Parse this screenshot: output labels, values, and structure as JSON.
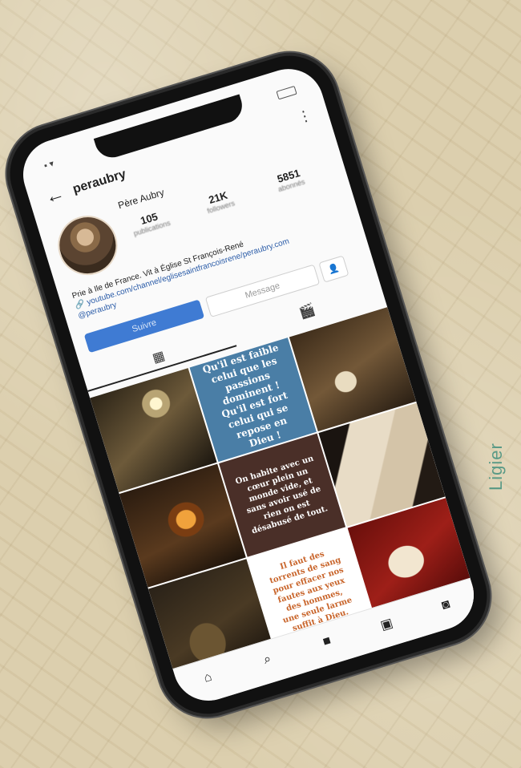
{
  "profile": {
    "username": "peraubry",
    "display_name": "Père Aubry",
    "stats": [
      {
        "value": "105",
        "label": "publications"
      },
      {
        "value": "21K",
        "label": "followers"
      },
      {
        "value": "5851",
        "label": "abonnés"
      }
    ],
    "bio": "Prie à Ile de France. Vit à Église St François-René",
    "link": "youtube.com/channel/eglisesaintfrancoisrene/peraubry.com",
    "handle": "@peraubry"
  },
  "buttons": {
    "follow": "Suivre",
    "message": "Message"
  },
  "quotes": {
    "q1": [
      "Qu'il est faible",
      "celui que les",
      "passions",
      "dominent !",
      "Qu'il est fort",
      "celui qui se",
      "repose en",
      "Dieu !"
    ],
    "q2": [
      "On habite avec un",
      "cœur plein un",
      "monde vide, et",
      "sans avoir usé de",
      "rien on est",
      "désabusé de tout."
    ],
    "q3": [
      "Il faut des",
      "torrents de sang",
      "pour effacer nos",
      "fautes aux yeux",
      "des hommes,",
      "une seule larme",
      "suffit à Dieu."
    ]
  },
  "credit": "Ligier",
  "colors": {
    "follow_button": "#3f7bd3",
    "quote1_bg": "#4a7ea6",
    "quote2_bg": "#4a2f28",
    "quote3_text": "#c8642a"
  },
  "icons": [
    "back-arrow-icon",
    "grid-icon",
    "video-icon",
    "home-icon",
    "search-icon",
    "reels-icon",
    "shop-icon",
    "profile-icon"
  ]
}
